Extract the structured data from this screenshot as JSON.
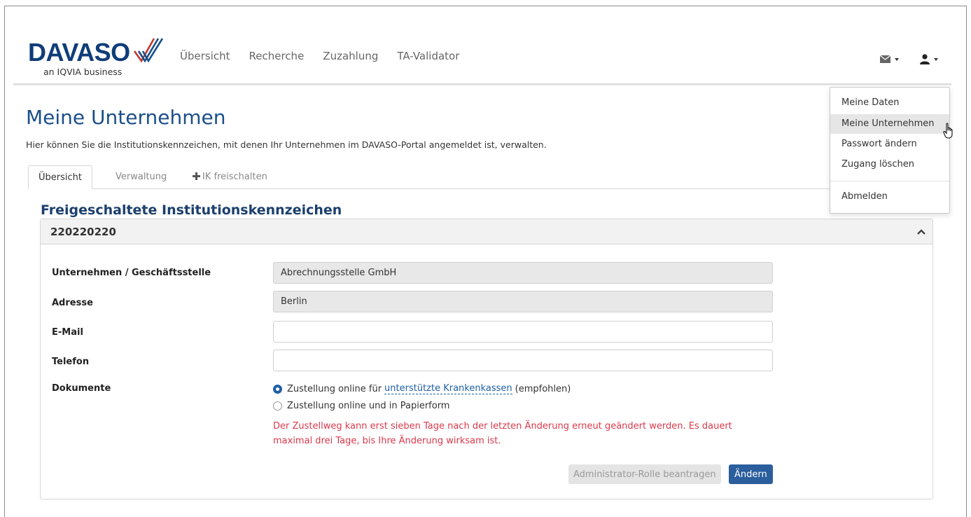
{
  "brand": {
    "name": "DAVASO",
    "tagline": "an IQVIA business",
    "color": "#0f3d78",
    "check_colors": [
      "#c0392b",
      "#1b4f8a"
    ]
  },
  "nav": {
    "items": [
      {
        "label": "Übersicht"
      },
      {
        "label": "Recherche"
      },
      {
        "label": "Zuzahlung"
      },
      {
        "label": "TA-Validator"
      }
    ]
  },
  "top_icons": {
    "mail": "envelope-icon",
    "user": "user-icon"
  },
  "page": {
    "title": "Meine Unternehmen",
    "description": "Hier können Sie die Institutionskennzeichen, mit denen Ihr Unternehmen im DAVASO-Portal angemeldet ist, verwalten."
  },
  "tabs": [
    {
      "label": "Übersicht",
      "active": true
    },
    {
      "label": "Verwaltung",
      "active": false
    },
    {
      "label": "IK freischalten",
      "icon": "plus-icon",
      "active": false
    }
  ],
  "section": {
    "title": "Freigeschaltete Institutionskennzeichen"
  },
  "panel": {
    "ik": "220220220",
    "fields": {
      "company_label": "Unternehmen / Geschäftsstelle",
      "company_value": "Abrechnungsstelle GmbH",
      "address_label": "Adresse",
      "address_value": "Berlin",
      "email_label": "E-Mail",
      "email_value": "",
      "phone_label": "Telefon",
      "phone_value": "",
      "documents_label": "Dokumente"
    },
    "radio_online": {
      "prefix": "Zustellung online für",
      "link": "unterstützte Krankenkassen",
      "suffix": "(empfohlen)",
      "selected": true
    },
    "radio_paper": {
      "label": "Zustellung online und in Papierform",
      "selected": false
    },
    "warning": "Der Zustellweg kann erst sieben Tage nach der letzten Änderung erneut geändert werden. Es dauert maximal drei Tage, bis Ihre Änderung wirksam ist.",
    "btn_admin": "Administrator-Rolle beantragen",
    "btn_change": "Ändern"
  },
  "dropdown": {
    "items": [
      {
        "label": "Meine Daten"
      },
      {
        "label": "Meine Unternehmen",
        "hover": true
      },
      {
        "label": "Passwort ändern"
      },
      {
        "label": "Zugang löschen"
      },
      {
        "label": "Abmelden"
      }
    ]
  },
  "colors": {
    "accent": "#1b4f8a",
    "primary_button": "#2a5e9c",
    "warning": "#d9394b",
    "readonly_field": "#e8e8e8"
  }
}
